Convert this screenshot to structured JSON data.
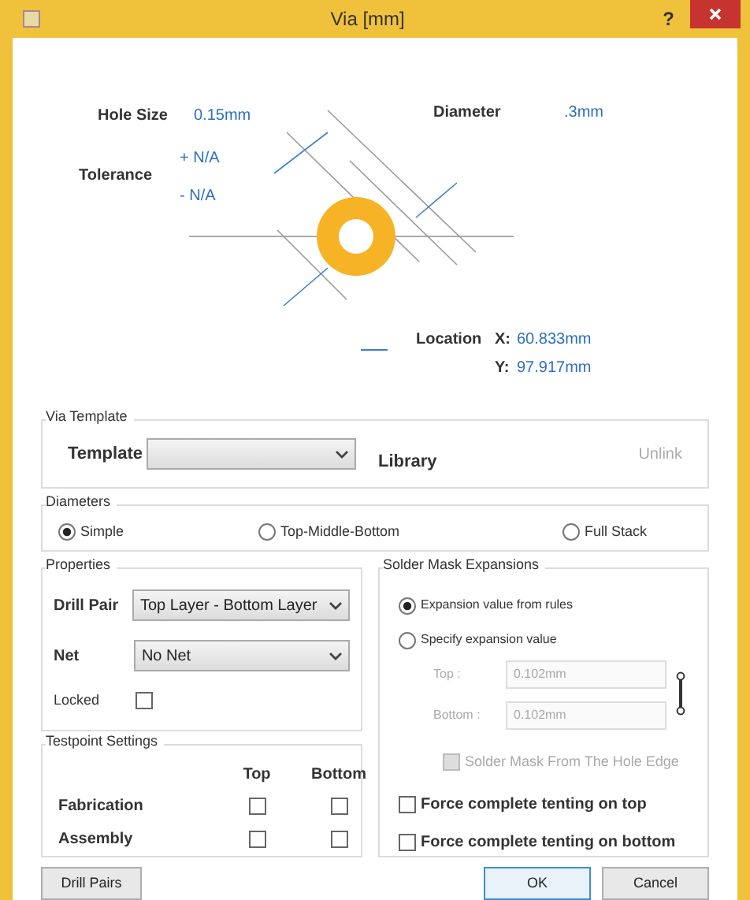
{
  "window": {
    "title": "Via [mm]",
    "help": "?"
  },
  "diagram": {
    "hole_size": {
      "label": "Hole Size",
      "value": "0.15mm"
    },
    "tolerance": {
      "label": "Tolerance",
      "plus": "+ N/A",
      "minus": "- N/A"
    },
    "diameter": {
      "label": "Diameter",
      "value": ".3mm"
    },
    "location": {
      "label": "Location",
      "x_label": "X:",
      "x": "60.833mm",
      "y_label": "Y:",
      "y": "97.917mm"
    }
  },
  "via_template": {
    "title": "Via Template",
    "template_label": "Template",
    "library": "Library",
    "unlink": "Unlink",
    "unlink_disabled": true
  },
  "diameters": {
    "title": "Diameters",
    "options": [
      {
        "label": "Simple",
        "selected": true
      },
      {
        "label": "Top-Middle-Bottom",
        "selected": false
      },
      {
        "label": "Full Stack",
        "selected": false
      }
    ]
  },
  "properties": {
    "title": "Properties",
    "drill_pair": {
      "label": "Drill Pair",
      "value": "Top Layer - Bottom Layer"
    },
    "net": {
      "label": "Net",
      "value": "No Net"
    },
    "locked": {
      "label": "Locked",
      "checked": false
    }
  },
  "testpoint": {
    "title": "Testpoint Settings",
    "columns": [
      "Top",
      "Bottom"
    ],
    "rows": [
      {
        "label": "Fabrication",
        "top": false,
        "bottom": false
      },
      {
        "label": "Assembly",
        "top": false,
        "bottom": false
      }
    ]
  },
  "solder_mask": {
    "title": "Solder Mask Expansions",
    "options": [
      {
        "label": "Expansion value from rules",
        "selected": true
      },
      {
        "label": "Specify expansion value",
        "selected": false
      }
    ],
    "fields": [
      {
        "label": "Top :",
        "value": "0.102mm",
        "disabled": true
      },
      {
        "label": "Bottom :",
        "value": "0.102mm",
        "disabled": true
      }
    ],
    "from_hole_edge": {
      "label": "Solder Mask From The Hole Edge",
      "checked": false,
      "disabled": true
    },
    "tenting": [
      {
        "label": "Force complete tenting on top",
        "checked": false
      },
      {
        "label": "Force complete tenting on bottom",
        "checked": false
      }
    ]
  },
  "buttons": [
    {
      "label": "Drill Pairs",
      "default": false
    },
    {
      "label": "OK",
      "default": true
    },
    {
      "label": "Cancel",
      "default": false
    }
  ]
}
